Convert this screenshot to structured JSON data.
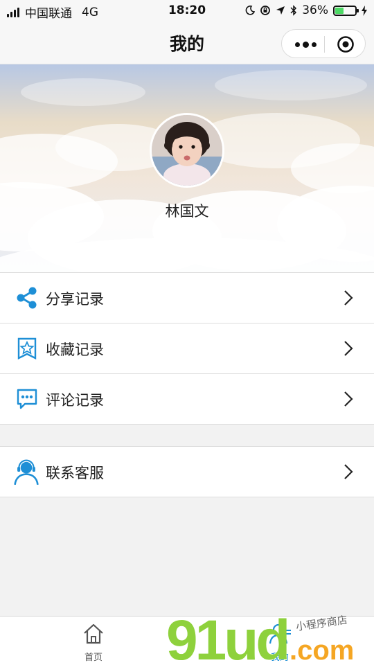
{
  "status_bar": {
    "carrier": "中国联通",
    "network": "4G",
    "time": "18:20",
    "battery": "36%",
    "battery_level": 0.36
  },
  "navbar": {
    "title": "我的",
    "more_icon": "more-dots-icon",
    "close_icon": "target-close-icon"
  },
  "profile": {
    "username": "林国文"
  },
  "menu": {
    "items": [
      {
        "label": "分享记录",
        "icon": "share-icon"
      },
      {
        "label": "收藏记录",
        "icon": "favorite-star-icon"
      },
      {
        "label": "评论记录",
        "icon": "comment-icon"
      }
    ],
    "service": {
      "label": "联系客服",
      "icon": "customer-service-icon"
    }
  },
  "tabbar": {
    "tabs": [
      {
        "label": "首页",
        "icon": "home-icon"
      },
      {
        "label": "我的",
        "icon": "user-icon"
      }
    ]
  },
  "watermark": {
    "brand": "91ud.com",
    "subtitle": "小程序商店"
  },
  "colors": {
    "accent": "#1e8fd6",
    "watermark_green": "#8ed13c",
    "watermark_orange": "#f5a623"
  }
}
